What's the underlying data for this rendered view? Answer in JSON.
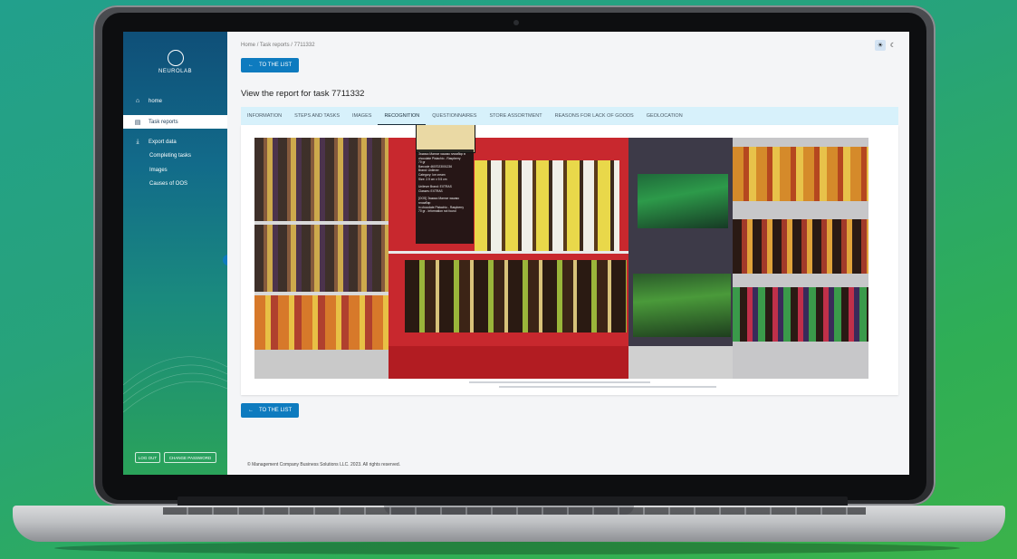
{
  "sidebar": {
    "logo_text": "NEUROLAB",
    "items": [
      {
        "label": "home",
        "icon": "home-icon"
      },
      {
        "label": "Task reports",
        "icon": "document-icon"
      },
      {
        "label": "Export data",
        "icon": "download-icon"
      }
    ],
    "sub_items": [
      "Completing tasks",
      "Images",
      "Causes of OOS"
    ],
    "logout": "LOG OUT",
    "change_password": "CHANGE PASSWORD"
  },
  "breadcrumb": {
    "home": "Home",
    "sep": "/",
    "task_reports": "Task reports",
    "task": "7711332"
  },
  "buttons": {
    "to_list": "TO THE LIST"
  },
  "page_title": "View the report for task 7711332",
  "tabs": [
    "INFORMATION",
    "STEPS AND TASKS",
    "IMAGES",
    "RECOGNITION",
    "QUESTIONNAIRES",
    "STORE ASSORTMENT",
    "REASONS FOR LACK OF GOODS",
    "GEOLOCATION"
  ],
  "active_tab": "RECOGNITION",
  "tooltip": {
    "line1": "Эскимо Магнат эскимо пломбир в",
    "line2": "chocolate Pistachio - Raspberry",
    "line3": "70 gr",
    "line4": "Barcode 4607023001236",
    "line5": "Brand: Unilever",
    "line6": "Category: Ice cream",
    "line7": "Size: 2.9 cm x 9.5 cm",
    "line8": "Unilever Brand: EXTRAS",
    "line9": "Classes: EXTRAS",
    "line10": "[OOS] Эскимо Магнат эскимо пломбир",
    "line11": "in chocolate Pistachio - Raspberry",
    "line12": "70 gr  - Information not found"
  },
  "footer": "© Management Company Business Solutions LLC. 2023. All rights reserved.",
  "colors": {
    "accent": "#0e7bbf",
    "tabs_bg": "#d7f1fb",
    "sidebar_top": "#0f4f78",
    "sidebar_bottom": "#2aa35a"
  }
}
